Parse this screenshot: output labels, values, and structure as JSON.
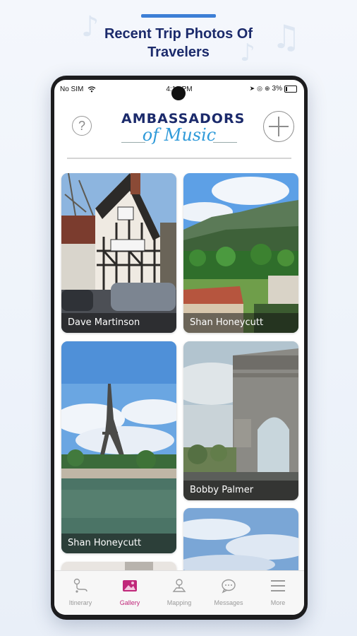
{
  "headline": {
    "line1": "Recent Trip Photos Of",
    "line2": "Travelers"
  },
  "status_bar": {
    "carrier": "No SIM",
    "time": "4:19 PM",
    "battery": "3%"
  },
  "header": {
    "logo_line1": "AMBASSADORS",
    "logo_line2": "of Music",
    "help_icon": "question-circle-icon",
    "add_icon": "plus-circle-icon"
  },
  "gallery": {
    "photos": [
      {
        "name": "Dave Martinson",
        "scene": "tudor-house"
      },
      {
        "name": "Shan Honeycutt",
        "scene": "mountain-village"
      },
      {
        "name": "Shan Honeycutt",
        "scene": "eiffel-tower"
      },
      {
        "name": "Bobby Palmer",
        "scene": "arc-de-triomphe"
      },
      {
        "name": "",
        "scene": "sky"
      },
      {
        "name": "",
        "scene": "partial"
      }
    ]
  },
  "tabbar": {
    "tabs": [
      {
        "label": "Itinerary",
        "icon": "route-pin-icon",
        "active": false
      },
      {
        "label": "Gallery",
        "icon": "image-icon",
        "active": true
      },
      {
        "label": "Mapping",
        "icon": "map-pin-icon",
        "active": false
      },
      {
        "label": "Messages",
        "icon": "chat-bubble-icon",
        "active": false
      },
      {
        "label": "More",
        "icon": "menu-icon",
        "active": false
      }
    ]
  },
  "colors": {
    "brand_navy": "#1b2a6b",
    "brand_blue": "#2f9ad9",
    "active_tab": "#c0287a",
    "accent_bar": "#3d7fd6"
  }
}
